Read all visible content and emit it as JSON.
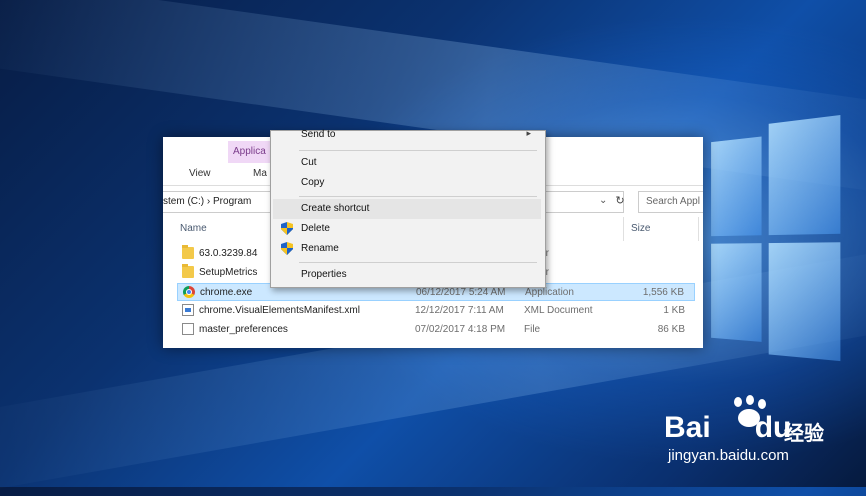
{
  "explorer": {
    "ribbon": {
      "context_tab": "Applica",
      "view_tab": "View",
      "manage_tab_partial": "Ma"
    },
    "address": {
      "path_left": "stem (C:)",
      "separator": "›",
      "path_right": "Program"
    },
    "search": {
      "placeholder": "Search Appl"
    },
    "columns": {
      "name": "Name",
      "type_partial": "",
      "size": "Size"
    },
    "files": [
      {
        "name": "63.0.3239.84",
        "date": "",
        "type": "folder",
        "size": "",
        "icon": "folder-icon"
      },
      {
        "name": "SetupMetrics",
        "date": "",
        "type": "folder",
        "size": "",
        "icon": "folder-icon"
      },
      {
        "name": "chrome.exe",
        "date": "06/12/2017 5:24 AM",
        "type": "Application",
        "size": "1,556 KB",
        "icon": "chrome-icon",
        "selected": true
      },
      {
        "name": "chrome.VisualElementsManifest.xml",
        "date": "12/12/2017 7:11 AM",
        "type": "XML Document",
        "size": "1 KB",
        "icon": "xml-document-icon"
      },
      {
        "name": "master_preferences",
        "date": "07/02/2017 4:18 PM",
        "type": "File",
        "size": "86 KB",
        "icon": "file-icon"
      }
    ]
  },
  "context_menu": {
    "send_to": "Send to",
    "cut": "Cut",
    "copy": "Copy",
    "create_shortcut": "Create shortcut",
    "delete": "Delete",
    "rename": "Rename",
    "properties": "Properties"
  },
  "watermark": {
    "brand_left": "Bai",
    "brand_right": "du",
    "brand_cn": "经验",
    "url": "jingyan.baidu.com"
  },
  "colors": {
    "selection": "#cce8ff",
    "context_tab": "#f0d8f6",
    "menu_bg": "#f2f2f2",
    "menu_hover": "#e5e5e5"
  }
}
